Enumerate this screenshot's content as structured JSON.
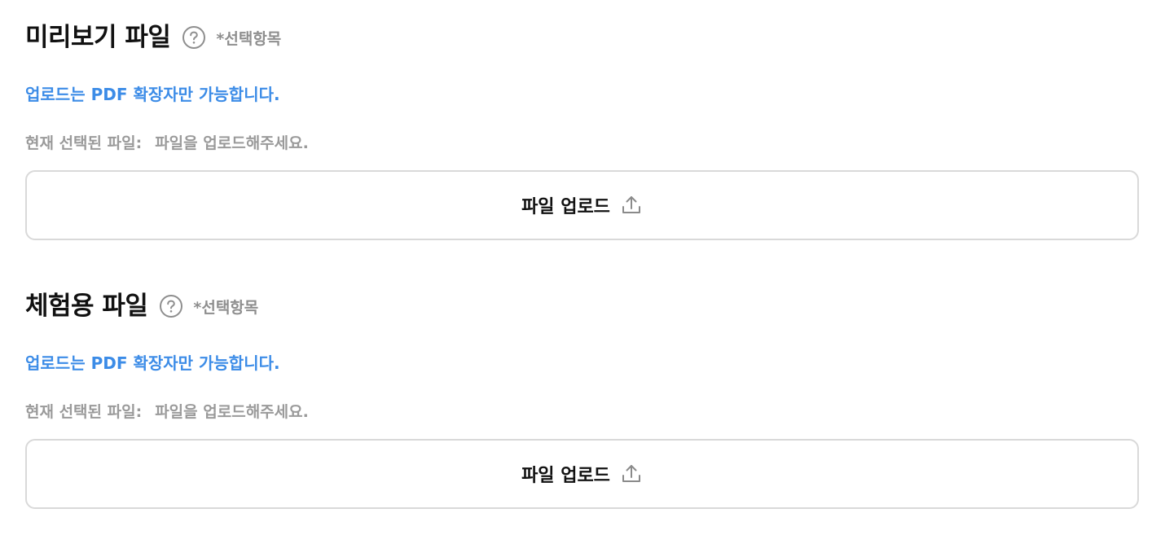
{
  "sections": [
    {
      "title": "미리보기 파일",
      "optional_label": "*선택항목",
      "notice": "업로드는 PDF 확장자만 가능합니다.",
      "current_file_label": "현재 선택된 파일:",
      "current_file_value": "파일을 업로드해주세요.",
      "upload_button_label": "파일 업로드"
    },
    {
      "title": "체험용 파일",
      "optional_label": "*선택항목",
      "notice": "업로드는 PDF 확장자만 가능합니다.",
      "current_file_label": "현재 선택된 파일:",
      "current_file_value": "파일을 업로드해주세요.",
      "upload_button_label": "파일 업로드"
    }
  ],
  "icons": {
    "help": "question-circle-icon",
    "upload": "upload-icon"
  },
  "colors": {
    "notice": "#3c8ce7",
    "muted": "#9a9a9a",
    "border": "#d9d9d9"
  }
}
